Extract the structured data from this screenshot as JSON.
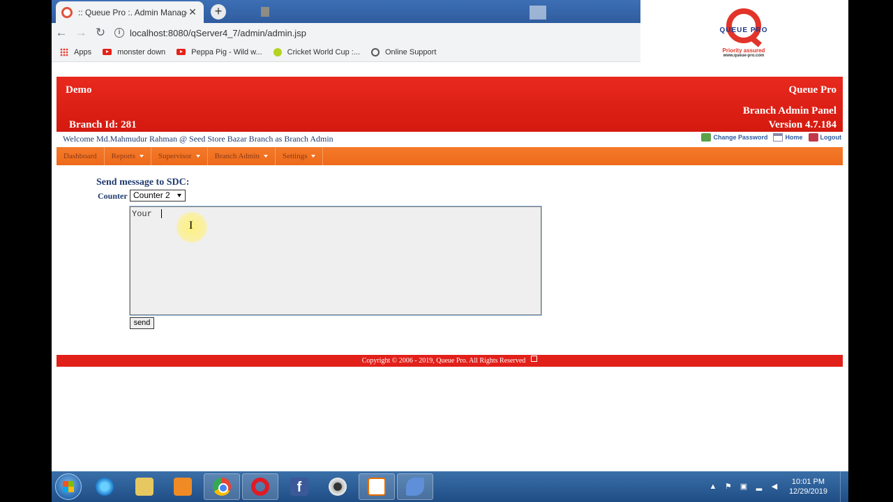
{
  "browser": {
    "tab_title": ":: Queue Pro :. Admin Manager",
    "new_tab": "+",
    "url": "localhost:8080/qServer4_7/admin/admin.jsp",
    "bookmarks": [
      {
        "label": "Apps",
        "icon": "apps-icon"
      },
      {
        "label": "monster down",
        "icon": "youtube-icon"
      },
      {
        "label": "Peppa Pig - Wild w...",
        "icon": "youtube-icon"
      },
      {
        "label": "Cricket World Cup :...",
        "icon": "cricket-ball-icon"
      },
      {
        "label": "Online Support",
        "icon": "globe-icon"
      }
    ]
  },
  "logo": {
    "word": "QUEUE PRO",
    "tagline": "Priority assured",
    "site": "www.queue-pro.com"
  },
  "header": {
    "left_top": "Demo",
    "right_top": "Queue Pro",
    "right_mid": "Branch Admin Panel",
    "branch_id": "Branch Id: 281",
    "version": "Version 4.7.184"
  },
  "welcome": "Welcome Md.Mahmudur Rahman @ Seed Store Bazar Branch as Branch Admin",
  "top_links": {
    "change_password": "Change Password",
    "home": "Home",
    "logout": "Logout"
  },
  "menu": [
    "Dashboard",
    "Reports",
    "Supervisor",
    "Branch Admin",
    "Settings"
  ],
  "form": {
    "title": "Send message to SDC:",
    "counter_label": "Counter",
    "counter_value": "Counter 2",
    "message": "Your ",
    "send_label": "send"
  },
  "footer": "Copyright © 2006 - 2019, Queue Pro. All Rights Reserved",
  "taskbar": {
    "apps": [
      "internet-explorer",
      "file-explorer",
      "media-player",
      "chrome",
      "opera",
      "facebook",
      "webcam",
      "java",
      "dolphin"
    ],
    "time": "10:01 PM",
    "date": "12/29/2019"
  },
  "colors": {
    "header_red": "#e2201a",
    "menu_orange": "#f37a2a",
    "text_navy": "#1e3a6e"
  }
}
